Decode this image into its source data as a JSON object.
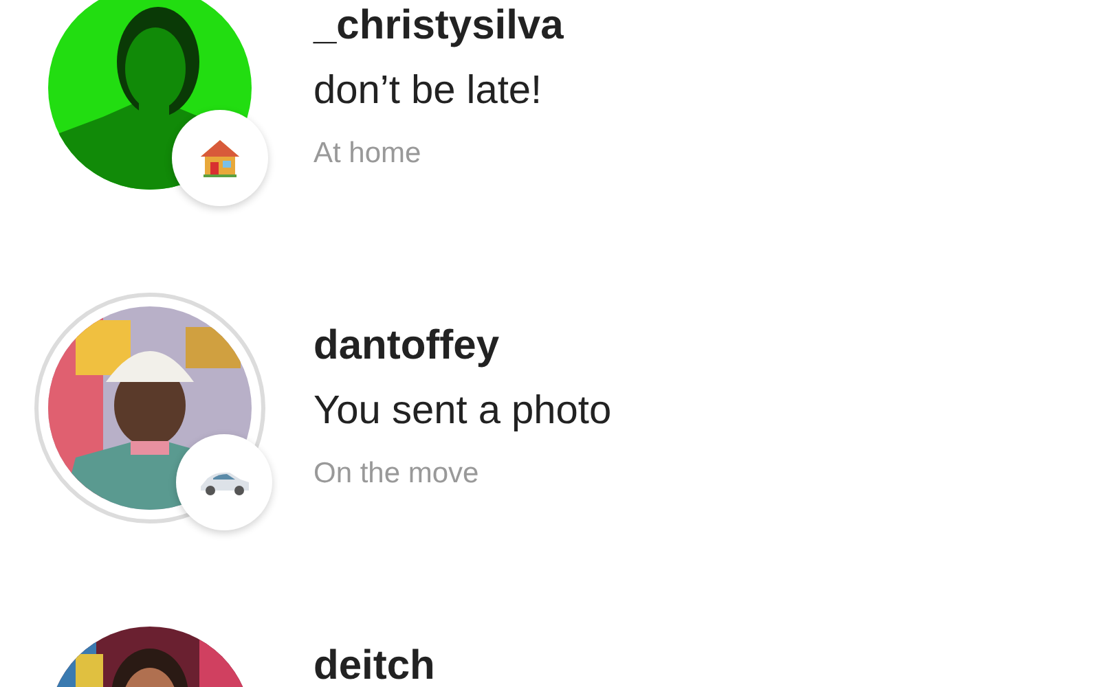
{
  "conversations": [
    {
      "username": "_christysilva",
      "message": "don’t be late!",
      "status": "At home",
      "badge": {
        "kind": "home"
      },
      "story_ring": false
    },
    {
      "username": "dantoffey",
      "message": "You sent a photo",
      "status": "On the move",
      "badge": {
        "kind": "car"
      },
      "story_ring": true
    },
    {
      "username": "deitch",
      "story_ring": false
    }
  ]
}
